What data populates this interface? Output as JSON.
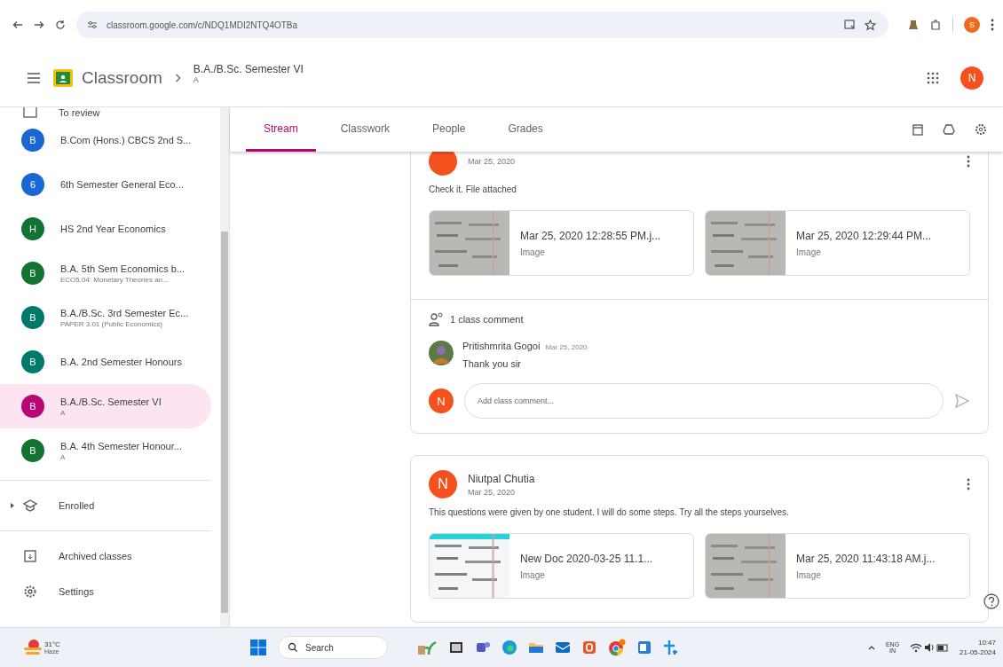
{
  "browser": {
    "url": "classroom.google.com/c/NDQ1MDI2NTQ4OTBa",
    "profile_initial": "S"
  },
  "header": {
    "app_name": "Classroom",
    "class_title": "B.A./B.Sc. Semester VI",
    "class_section": "A",
    "avatar_initial": "N"
  },
  "sidebar": {
    "partial_item": "To review",
    "classes": [
      {
        "initial": "B",
        "title": "B.Com (Hons.) CBCS 2nd S...",
        "color": "#1967d2",
        "selected": false
      },
      {
        "initial": "6",
        "title": "6th Semester General Eco...",
        "color": "#1967d2",
        "selected": false
      },
      {
        "initial": "H",
        "title": "HS 2nd Year Economics",
        "color": "#137333",
        "selected": false
      },
      {
        "initial": "B",
        "title": "B.A. 5th Sem Economics b...",
        "subtitle": "ECO5.04: Monetary Theories an...",
        "color": "#137333",
        "selected": false
      },
      {
        "initial": "B",
        "title": "B.A./B.Sc. 3rd Semester Ec...",
        "subtitle": "PAPER 3.01 (Public Economics)",
        "color": "#00796b",
        "selected": false
      },
      {
        "initial": "B",
        "title": "B.A. 2nd Semester Honours",
        "color": "#00796b",
        "selected": false
      },
      {
        "initial": "B",
        "title": "B.A./B.Sc. Semester VI",
        "subtitle": "A",
        "color": "#b80672",
        "selected": true
      },
      {
        "initial": "B",
        "title": "B.A. 4th Semester Honour...",
        "subtitle": "A",
        "color": "#137333",
        "selected": false
      }
    ],
    "enrolled": {
      "label": "Enrolled",
      "expanded": false
    },
    "archived": "Archived classes",
    "settings": "Settings"
  },
  "tabs": [
    {
      "label": "Stream",
      "selected": true
    },
    {
      "label": "Classwork",
      "selected": false
    },
    {
      "label": "People",
      "selected": false
    },
    {
      "label": "Grades",
      "selected": false
    }
  ],
  "posts": [
    {
      "date": "Mar 25, 2020",
      "text": "Check it. File attached",
      "attachments": [
        {
          "name": "Mar 25, 2020 12:28:55 PM.j...",
          "type": "Image"
        },
        {
          "name": "Mar 25, 2020 12:29:44 PM...",
          "type": "Image"
        }
      ],
      "comments": {
        "count": "1 class comment",
        "items": [
          {
            "author": "Pritishmrita Gogoi",
            "date": "Mar 25, 2020",
            "text": "Thank you sir"
          }
        ],
        "user_initial": "N",
        "placeholder": "Add class comment..."
      }
    },
    {
      "author": "Niutpal Chutia",
      "initial": "N",
      "date": "Mar 25, 2020",
      "text": "This questions were given by one student. I will do some steps. Try all the steps yourselves.",
      "attachments": [
        {
          "name": "New Doc 2020-03-25 11.1...",
          "type": "Image"
        },
        {
          "name": "Mar 25, 2020 11:43:18 AM.j...",
          "type": "Image"
        }
      ]
    }
  ],
  "taskbar": {
    "temperature": "31°C",
    "weather": "Haze",
    "search": "Search",
    "language": "ENG",
    "region": "IN",
    "time": "10:47",
    "date": "21-05-2024"
  }
}
